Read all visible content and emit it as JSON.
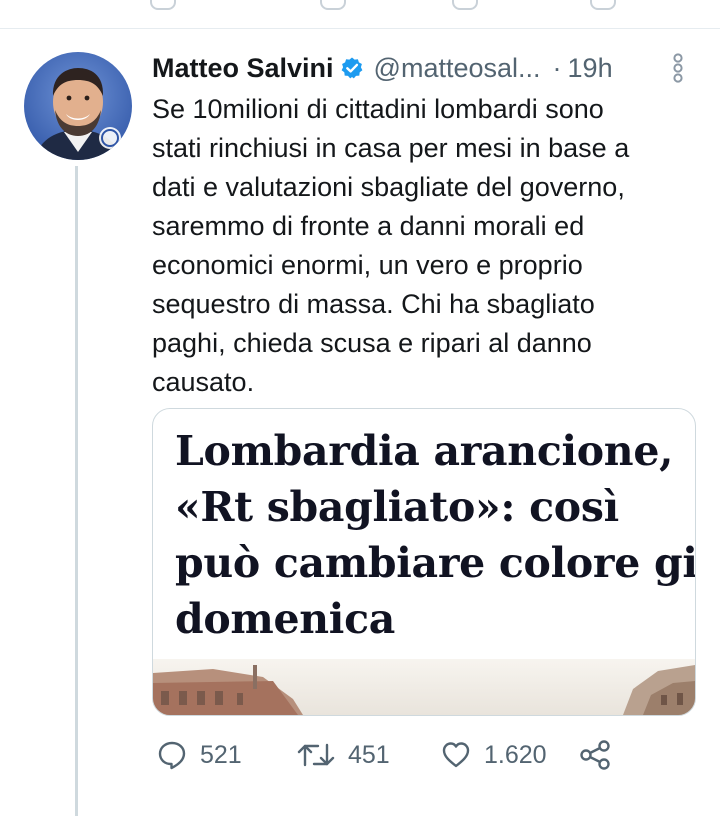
{
  "tweet": {
    "author_name": "Matteo Salvini",
    "handle": "@matteosal...",
    "separator": "·",
    "time": "19h",
    "text_lines": [
      "Se 10milioni di cittadini lombardi sono",
      "stati rinchiusi in casa per mesi in base a",
      "dati e valutazioni sbagliate del governo,",
      "saremmo di fronte a danni morali ed",
      "economici enormi, un vero e proprio",
      "sequestro di massa. Chi ha sbagliato",
      "paghi, chieda scusa e ripari al danno",
      "causato."
    ],
    "card": {
      "headline_lines": [
        "Lombardia arancione,",
        "«Rt sbagliato»: così",
        "può cambiare colore già",
        "domenica"
      ]
    },
    "actions": {
      "replies": "521",
      "retweets": "451",
      "likes": "1.620"
    },
    "icons": {
      "verified": "verified-badge-icon",
      "more": "more-vertical-icon",
      "reply": "reply-icon",
      "retweet": "retweet-icon",
      "like": "heart-icon",
      "share": "share-icon"
    },
    "colors": {
      "verified": "#1d9bf0",
      "text": "#14171a",
      "muted": "#536471",
      "border": "#cfd9de"
    }
  }
}
